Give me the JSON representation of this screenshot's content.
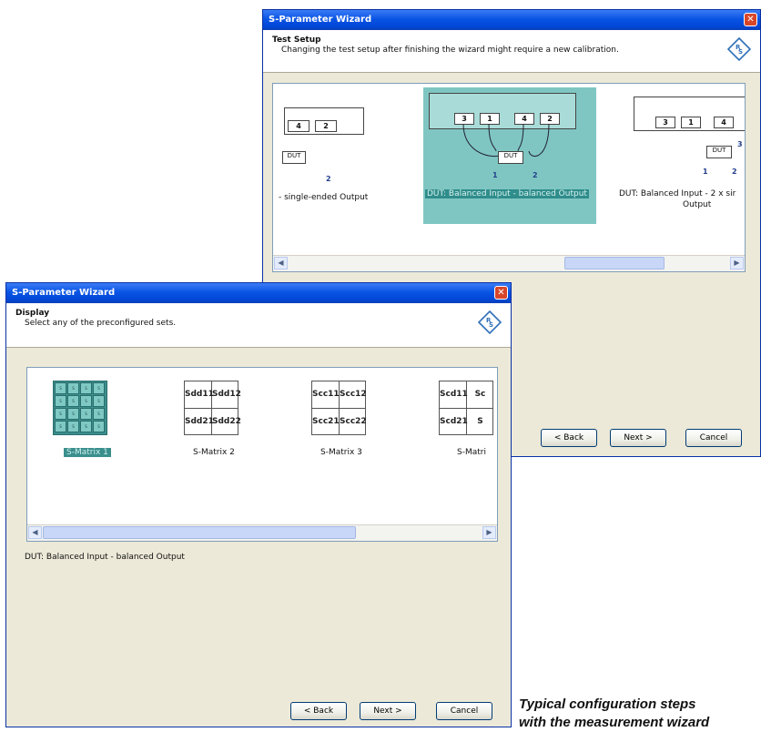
{
  "window_back": {
    "title": "S-Parameter Wizard",
    "close": "✕",
    "header_title": "Test Setup",
    "header_sub": "Changing the test setup after finishing the wizard might require a new calibration.",
    "setups": [
      {
        "caption": "- single-ended Output"
      },
      {
        "caption": "DUT: Balanced Input - balanced Output",
        "selected": true
      },
      {
        "caption_line1": "DUT: Balanced Input - 2 x sir",
        "caption_line2": "Output"
      }
    ],
    "port_labels": [
      "4",
      "2",
      "3",
      "1",
      "4",
      "2",
      "3",
      "1",
      "4"
    ],
    "dut_label": "DUT",
    "pin_numbers": [
      "2",
      "1",
      "2",
      "1",
      "2",
      "3"
    ],
    "buttons": {
      "back": "< Back",
      "next": "Next >",
      "cancel": "Cancel"
    }
  },
  "window_front": {
    "title": "S-Parameter Wizard",
    "close": "✕",
    "header_title": "Display",
    "header_sub": "Select any of the preconfigured sets.",
    "matrices": [
      {
        "label": "S-Matrix 1",
        "selected": true
      },
      {
        "label": "S-Matrix 2",
        "cells": [
          "Sdd11",
          "Sdd12",
          "Sdd21",
          "Sdd22"
        ]
      },
      {
        "label": "S-Matrix 3",
        "cells": [
          "Scc11",
          "Scc12",
          "Scc21",
          "Scc22"
        ]
      },
      {
        "label": "S-Matri",
        "cells": [
          "Scd11",
          "Sc",
          "Scd21",
          "S"
        ]
      }
    ],
    "mini_cells": [
      "S",
      "S",
      "S",
      "S",
      "S",
      "S",
      "S",
      "S",
      "S",
      "S",
      "S",
      "S",
      "S",
      "S",
      "S",
      "S"
    ],
    "description": "DUT: Balanced Input - balanced Output",
    "buttons": {
      "back": "< Back",
      "next": "Next >",
      "cancel": "Cancel"
    }
  },
  "caption": {
    "line1": "Typical configuration steps",
    "line2": "with the measurement wizard"
  },
  "colors": {
    "titlebar": "#0a54e4",
    "selection": "#3a8f8d",
    "dialog_bg": "#ece9d8",
    "close_button": "#d8462a"
  }
}
